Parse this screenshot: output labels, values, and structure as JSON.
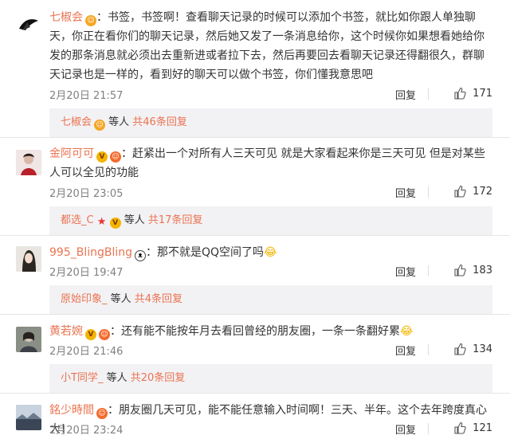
{
  "comments": [
    {
      "user": "七椒会",
      "text": "：书签，书签啊！查看聊天记录的时候可以添加个书签，就比如你跟人单独聊天，你正在看你们的聊天记录，然后她又发了一条消息给你，这个时候你如果想看她给你发的那条消息就必须出去重新进或者拉下去，然后再要回去看聊天记录还得翻很久，群聊天记录也是一样的，看到好的聊天可以做个书签，你们懂我意思吧",
      "time": "2月20日 21:57",
      "reply": "回复",
      "likes": "171",
      "thread_user": "七椒会",
      "thread_mid": " 等人 ",
      "thread_count": "共46条回复"
    },
    {
      "user": "金阿可可",
      "text": "：赶紧出一个对所有人三天可见 就是大家看起来你是三天可见 但是对某些人可以全见的功能",
      "time": "2月20日 23:05",
      "reply": "回复",
      "likes": "172",
      "thread_user": "都选_C",
      "thread_mid": " 等人 ",
      "thread_count": "共17条回复"
    },
    {
      "user": "995_BlingBling",
      "text": "：那不就是QQ空间了吗",
      "time": "2月20日 19:47",
      "reply": "回复",
      "likes": "183",
      "thread_user": "原始印象_",
      "thread_mid": " 等人 ",
      "thread_count": "共4条回复"
    },
    {
      "user": "黄若婉",
      "text": "：还有能不能按年月去看回曾经的朋友圈，一条一条翻好累",
      "time": "2月20日 21:46",
      "reply": "回复",
      "likes": "134",
      "thread_user": "小T同学_",
      "thread_mid": " 等人 ",
      "thread_count": "共20条回复"
    },
    {
      "user": "銘少時間",
      "text": "：朋友圈几天可见，能不能任意输入时间啊！三天、半年。这个去年跨度真心大！",
      "time": "2月20日 23:24",
      "reply": "回复",
      "likes": "121"
    }
  ],
  "colors": {
    "username": "#eb7350",
    "thread_bg": "#f2f2f5",
    "meta": "#808080"
  },
  "icons": [
    "thumbs-up-icon",
    "avatar"
  ]
}
